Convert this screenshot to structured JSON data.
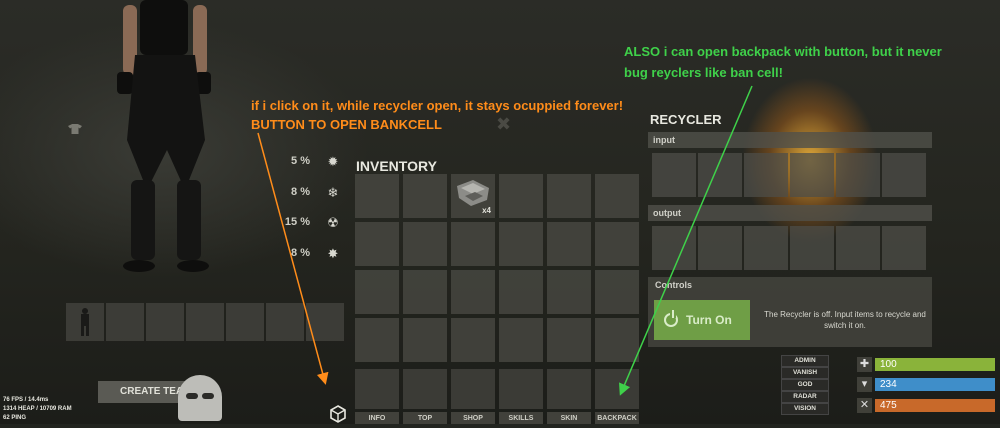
{
  "annotations": {
    "orange_line1": "if i click on it, while recycler open, it stays ocuppied forever!",
    "orange_line2": "BUTTON TO OPEN BANKCELL",
    "green_line1": "ALSO i can open backpack with button, but it never",
    "green_line2": "bug reyclers like ban cell!",
    "orange_color": "#ff8c1a",
    "green_color": "#3fd14a"
  },
  "stats": [
    {
      "pct": "5 %",
      "icon": "heat-icon"
    },
    {
      "pct": "8 %",
      "icon": "cold-icon"
    },
    {
      "pct": "15 %",
      "icon": "radiation-icon"
    },
    {
      "pct": "8 %",
      "icon": "explosion-icon"
    }
  ],
  "inventory": {
    "title": "INVENTORY",
    "item": {
      "slot": 2,
      "icon": "scrap-metal-icon",
      "quantity": "x4"
    }
  },
  "tabs": [
    "INFO",
    "TOP",
    "SHOP",
    "SKILLS",
    "SKIN",
    "BACKPACK"
  ],
  "recycler": {
    "title": "RECYCLER",
    "input_label": "input",
    "output_label": "output",
    "controls_label": "Controls",
    "turn_on_label": "Turn On",
    "status": "The Recycler is off. Input items to recycle and switch it on."
  },
  "admin_buttons": [
    "ADMIN",
    "VANISH",
    "GOD",
    "RADAR",
    "VISION"
  ],
  "vitals": [
    {
      "icon": "health-icon",
      "value": "100",
      "color": "#8ab33a"
    },
    {
      "icon": "water-icon",
      "value": "234",
      "color": "#3f8ec9"
    },
    {
      "icon": "food-icon",
      "value": "475",
      "color": "#c8692a"
    }
  ],
  "create_team_label": "CREATE TEAM",
  "perf": {
    "fps": "76 FPS / 14.4ms",
    "ram": "1314 HEAP / 10709 RAM",
    "ping": "62 PING"
  }
}
